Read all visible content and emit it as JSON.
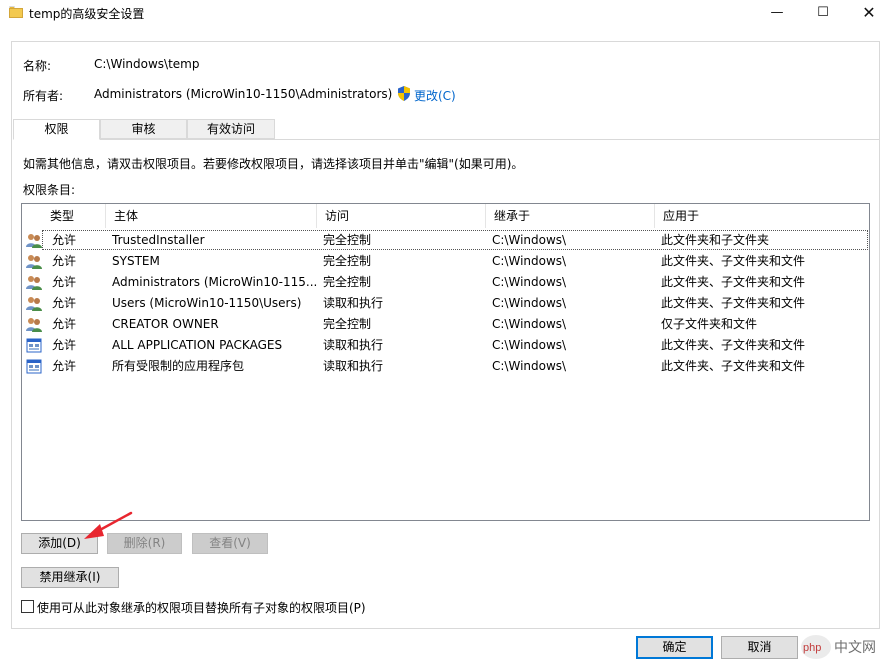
{
  "window": {
    "title": "temp的高级安全设置",
    "minimize_glyph": "—",
    "maximize_glyph": "☐",
    "close_glyph": "✕"
  },
  "info": {
    "name_label": "名称:",
    "name_value": "C:\\Windows\\temp",
    "owner_label": "所有者:",
    "owner_value": "Administrators (MicroWin10-1150\\Administrators)",
    "change_link": "更改(C)"
  },
  "tabs": [
    {
      "label": "权限",
      "active": true
    },
    {
      "label": "审核",
      "active": false
    },
    {
      "label": "有效访问",
      "active": false
    }
  ],
  "hint_text": "如需其他信息，请双击权限项目。若要修改权限项目，请选择该项目并单击\"编辑\"(如果可用)。",
  "entries_label": "权限条目:",
  "table": {
    "columns": [
      "类型",
      "主体",
      "访问",
      "继承于",
      "应用于"
    ],
    "rows": [
      {
        "icon": "users-icon",
        "type": "允许",
        "principal": "TrustedInstaller",
        "access": "完全控制",
        "inherited": "C:\\Windows\\",
        "applies": "此文件夹和子文件夹"
      },
      {
        "icon": "users-icon",
        "type": "允许",
        "principal": "SYSTEM",
        "access": "完全控制",
        "inherited": "C:\\Windows\\",
        "applies": "此文件夹、子文件夹和文件"
      },
      {
        "icon": "users-icon",
        "type": "允许",
        "principal": "Administrators (MicroWin10-115...",
        "access": "完全控制",
        "inherited": "C:\\Windows\\",
        "applies": "此文件夹、子文件夹和文件"
      },
      {
        "icon": "users-icon",
        "type": "允许",
        "principal": "Users (MicroWin10-1150\\Users)",
        "access": "读取和执行",
        "inherited": "C:\\Windows\\",
        "applies": "此文件夹、子文件夹和文件"
      },
      {
        "icon": "users-icon",
        "type": "允许",
        "principal": "CREATOR OWNER",
        "access": "完全控制",
        "inherited": "C:\\Windows\\",
        "applies": "仅子文件夹和文件"
      },
      {
        "icon": "app-package-icon",
        "type": "允许",
        "principal": "ALL APPLICATION PACKAGES",
        "access": "读取和执行",
        "inherited": "C:\\Windows\\",
        "applies": "此文件夹、子文件夹和文件"
      },
      {
        "icon": "app-package-icon",
        "type": "允许",
        "principal": "所有受限制的应用程序包",
        "access": "读取和执行",
        "inherited": "C:\\Windows\\",
        "applies": "此文件夹、子文件夹和文件"
      }
    ]
  },
  "buttons": {
    "add": "添加(D)",
    "remove": "删除(R)",
    "view": "查看(V)",
    "disable_inheritance": "禁用继承(I)",
    "ok": "确定",
    "cancel": "取消"
  },
  "replace_checkbox_label": "使用可从此对象继承的权限项目替换所有子对象的权限项目(P)",
  "colors": {
    "link": "#0066cc",
    "arrow": "#e8262f",
    "accent_border": "#0078d7"
  }
}
